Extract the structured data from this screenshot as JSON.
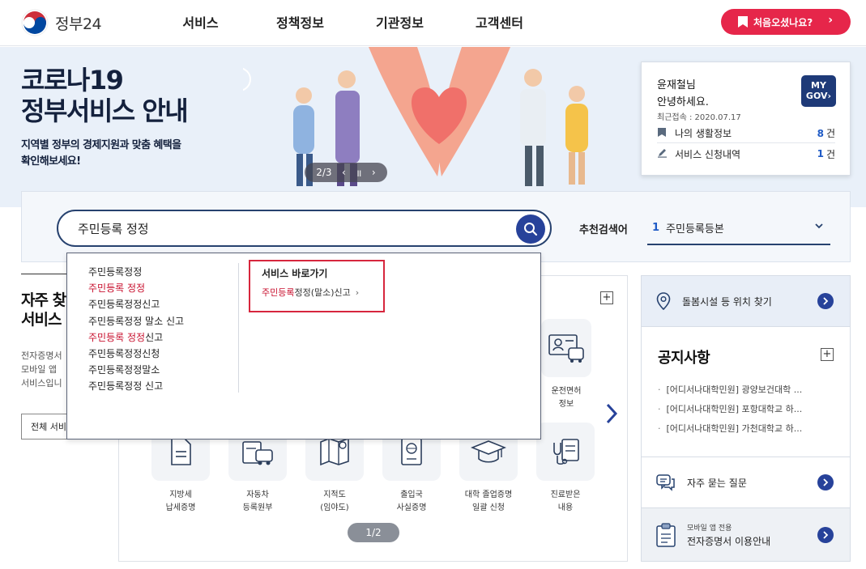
{
  "header": {
    "logo_text": "정부24",
    "nav": [
      "서비스",
      "정책정보",
      "기관정보",
      "고객센터"
    ],
    "first_visit": "처음오셨나요?"
  },
  "banner": {
    "title_lines": [
      "코로나19",
      "정부서비스 안내"
    ],
    "subtitle_lines": [
      "지역별 정부의 경제지원과 맞춤 혜택을",
      "확인해보세요!"
    ],
    "slide": "2/3"
  },
  "user_card": {
    "name": "윤재철",
    "name_suffix": "님",
    "greeting": "안녕하세요.",
    "last_login": "최근접속 : 2020.07.17",
    "mygov_line1": "MY",
    "mygov_line2": "GOV",
    "rows": [
      {
        "label": "나의 생활정보",
        "count": "8",
        "unit": "건"
      },
      {
        "label": "서비스 신청내역",
        "count": "1",
        "unit": "건"
      }
    ]
  },
  "search": {
    "value": "주민등록 정정",
    "recommend_label": "추천검색어",
    "recommend_num": "1",
    "recommend_text": "주민등록등본"
  },
  "autocomplete": {
    "items": [
      {
        "hl": "",
        "rest": "주민등록정정"
      },
      {
        "hl": "주민등록 정정",
        "rest": ""
      },
      {
        "hl": "",
        "rest": "주민등록정정신고"
      },
      {
        "hl": "",
        "rest": "주민등록정정 말소 신고"
      },
      {
        "hl": "주민등록 정정",
        "rest": "신고"
      },
      {
        "hl": "",
        "rest": "주민등록정정신청"
      },
      {
        "hl": "",
        "rest": "주민등록정정말소"
      },
      {
        "hl": "",
        "rest": "주민등록정정 신고"
      }
    ],
    "shortcut_title": "서비스 바로가기",
    "shortcut_hl": "주민등록",
    "shortcut_rest": "정정(말소)신고"
  },
  "left": {
    "title_lines": [
      "자주 찾",
      "서비스"
    ],
    "desc_lines": [
      "전자증명서",
      "모바일 앱",
      "서비스입니"
    ],
    "all_btn": "전체 서비"
  },
  "services": {
    "license": [
      "운전면허",
      "정보"
    ],
    "row2": [
      {
        "l1": "지방세",
        "l2": "납세증명",
        "icon": "document-icon"
      },
      {
        "l1": "자동차",
        "l2": "등록원부",
        "icon": "car-icon"
      },
      {
        "l1": "지적도",
        "l2": "(임야도)",
        "icon": "map-icon"
      },
      {
        "l1": "출입국",
        "l2": "사실증명",
        "icon": "passport-icon"
      },
      {
        "l1": "대학 졸업증명",
        "l2": "일괄 신청",
        "icon": "graduation-cap-icon"
      },
      {
        "l1": "진료받은",
        "l2": "내용",
        "icon": "stethoscope-icon"
      }
    ],
    "pager": "1/2"
  },
  "sidebar": {
    "facility": "돌봄시설 등 위치 찾기",
    "notice_title": "공지사항",
    "notices": [
      "[어디서나대학민원] 광양보건대학 ...",
      "[어디서나대학민원] 포항대학교 하...",
      "[어디서나대학민원] 가천대학교 하..."
    ],
    "faq": "자주 묻는 질문",
    "mobile_small": "모바일 앱 전용",
    "mobile_main": "전자증명서 이용안내"
  },
  "colors": {
    "accent_red": "#e6264a",
    "navy": "#27426f",
    "blue": "#27429a",
    "highlight_red": "#c8102e"
  }
}
